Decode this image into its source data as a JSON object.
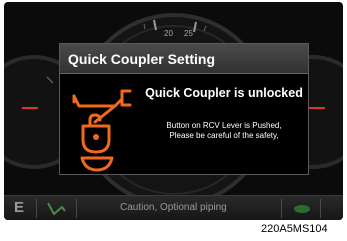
{
  "gauge": {
    "tick_labels": [
      "20",
      "25"
    ]
  },
  "dialog": {
    "title": "Quick Coupler Setting",
    "icon": "quick-coupler-unlock-icon",
    "message": "Quick Coupler is unlocked",
    "detail_line1": "Button on RCV Lever is Pushed,",
    "detail_line2": "Please be careful of the safety,"
  },
  "bottom_bar": {
    "mode": "E",
    "icon": "excavator-arm-icon",
    "caution": "Caution, Optional piping",
    "status_icon": "status-indicator-icon"
  },
  "caption": "220A5MS104",
  "colors": {
    "accent": "#f06a1e",
    "background": "#0b0b0b",
    "dialog_header": "#3c3c3c"
  }
}
